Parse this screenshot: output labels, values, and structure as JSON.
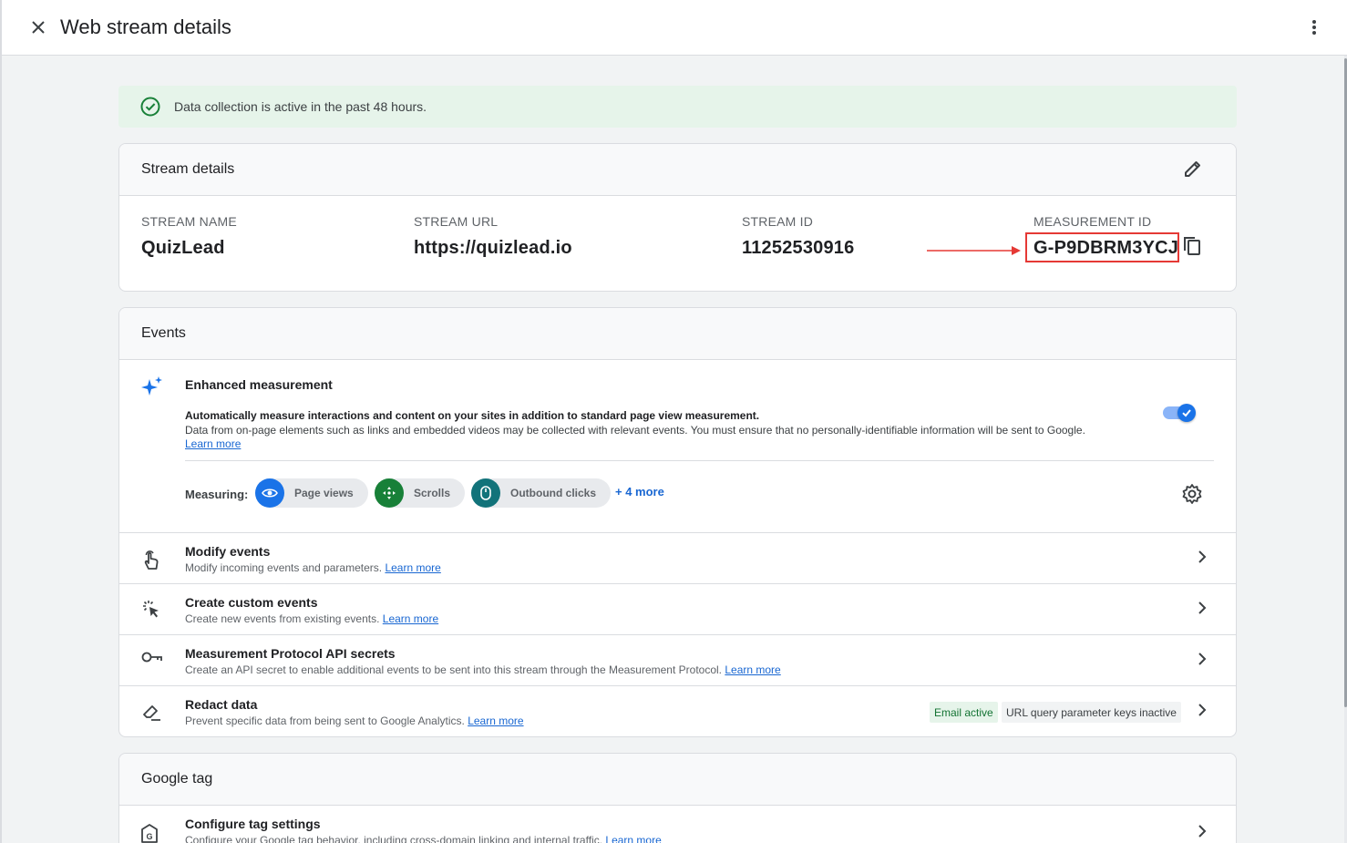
{
  "header": {
    "title": "Web stream details"
  },
  "banner": {
    "text": "Data collection is active in the past 48 hours."
  },
  "stream_details": {
    "heading": "Stream details",
    "fields": [
      {
        "label": "STREAM NAME",
        "value": "QuizLead"
      },
      {
        "label": "STREAM URL",
        "value": "https://quizlead.io"
      },
      {
        "label": "STREAM ID",
        "value": "11252530916"
      },
      {
        "label": "MEASUREMENT ID",
        "value": "G-P9DBRM3YCJ"
      }
    ]
  },
  "events": {
    "heading": "Events",
    "enhanced": {
      "title": "Enhanced measurement",
      "desc_bold": "Automatically measure interactions and content on your sites in addition to standard page view measurement.",
      "desc": "Data from on-page elements such as links and embedded videos may be collected with relevant events. You must ensure that no personally-identifiable information will be sent to Google.",
      "learn_more": "Learn more",
      "enabled": true,
      "measuring_label": "Measuring:",
      "chips": [
        {
          "label": "Page views",
          "color": "#1a73e8"
        },
        {
          "label": "Scrolls",
          "color": "#188038"
        },
        {
          "label": "Outbound clicks",
          "color": "#12737a"
        }
      ],
      "more": "+ 4 more"
    },
    "rows": [
      {
        "title": "Modify events",
        "sub": "Modify incoming events and parameters.",
        "link": "Learn more"
      },
      {
        "title": "Create custom events",
        "sub": "Create new events from existing events.",
        "link": "Learn more"
      },
      {
        "title": "Measurement Protocol API secrets",
        "sub": "Create an API secret to enable additional events to be sent into this stream through the Measurement Protocol.",
        "link": "Learn more"
      },
      {
        "title": "Redact data",
        "sub": "Prevent specific data from being sent to Google Analytics.",
        "link": "Learn more",
        "badges": [
          "Email active",
          "URL query parameter keys inactive"
        ]
      }
    ]
  },
  "google_tag": {
    "heading": "Google tag",
    "rows": [
      {
        "title": "Configure tag settings",
        "sub": "Configure your Google tag behavior, including cross-domain linking and internal traffic.",
        "link": "Learn more"
      }
    ]
  },
  "colors": {
    "accent": "#1a73e8",
    "banner_bg": "#e6f4ea",
    "success": "#188038",
    "highlight": "#e53935"
  }
}
